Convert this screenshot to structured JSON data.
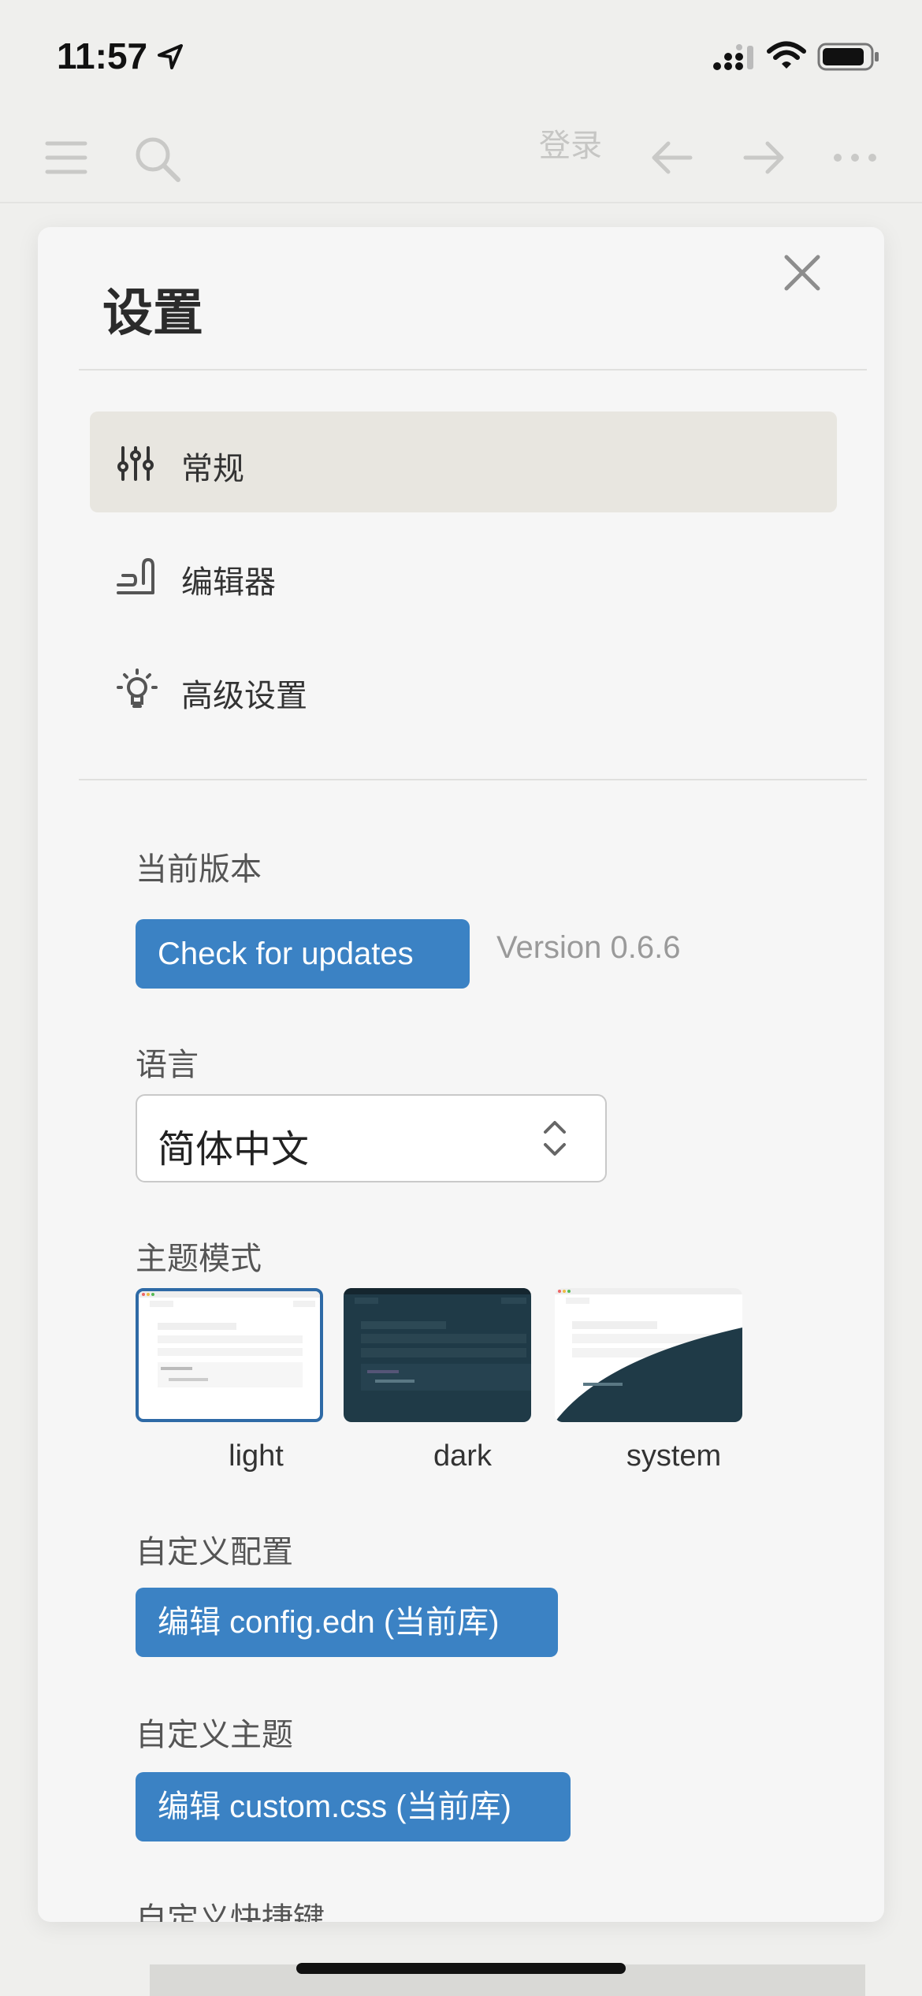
{
  "status_bar": {
    "time": "11:57"
  },
  "toolbar": {
    "login_label": "登录"
  },
  "settings": {
    "title": "设置",
    "nav": [
      {
        "label": "常规",
        "icon": "sliders-icon",
        "active": true
      },
      {
        "label": "编辑器",
        "icon": "editor-icon",
        "active": false
      },
      {
        "label": "高级设置",
        "icon": "bulb-icon",
        "active": false
      }
    ],
    "current_version_label": "当前版本",
    "check_updates_label": "Check for updates",
    "version_text": "Version 0.6.6",
    "language_label": "语言",
    "language_value": "简体中文",
    "theme_mode_label": "主题模式",
    "themes": [
      {
        "label": "light",
        "selected": true
      },
      {
        "label": "dark",
        "selected": false
      },
      {
        "label": "system",
        "selected": false
      }
    ],
    "custom_config_label": "自定义配置",
    "edit_config_label": "编辑 config.edn (当前库)",
    "custom_theme_label": "自定义主题",
    "edit_css_label": "编辑 custom.css (当前库)",
    "custom_shortcuts_label": "自定义快捷键"
  },
  "colors": {
    "accent": "#3b82c4",
    "active_nav": "#e8e6e0",
    "dark_theme": "#1f3a47"
  }
}
